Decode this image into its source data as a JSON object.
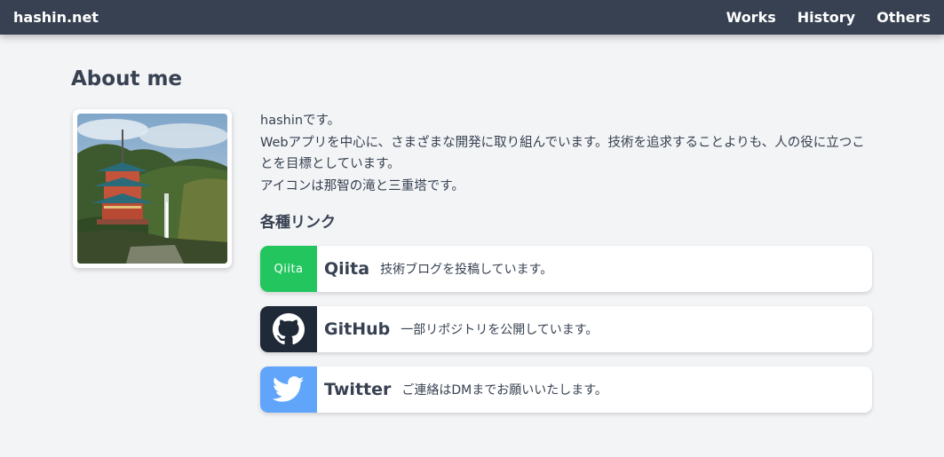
{
  "navbar": {
    "brand": "hashin.net",
    "links": [
      "Works",
      "History",
      "Others"
    ]
  },
  "about": {
    "title": "About me",
    "avatar_icon": "pagoda-waterfall-photo",
    "intro_lines": [
      "hashinです。",
      "Webアプリを中心に、さまざまな開発に取り組んでいます。技術を追求することよりも、人の役に立つことを目標としています。",
      "アイコンは那智の滝と三重塔です。"
    ]
  },
  "links": {
    "heading": "各種リンク",
    "items": [
      {
        "name": "Qiita",
        "description": "技術ブログを投稿しています。",
        "icon": "qiita-logo",
        "icon_text": "Qiita",
        "color": "#22c55e"
      },
      {
        "name": "GitHub",
        "description": "一部リポジトリを公開しています。",
        "icon": "github-icon",
        "color": "#1f2937"
      },
      {
        "name": "Twitter",
        "description": "ご連絡はDMまでお願いいたします。",
        "icon": "twitter-bird-icon",
        "color": "#60a5fa"
      }
    ]
  },
  "colors": {
    "navbar": "#374151",
    "background": "#f3f4f6"
  }
}
